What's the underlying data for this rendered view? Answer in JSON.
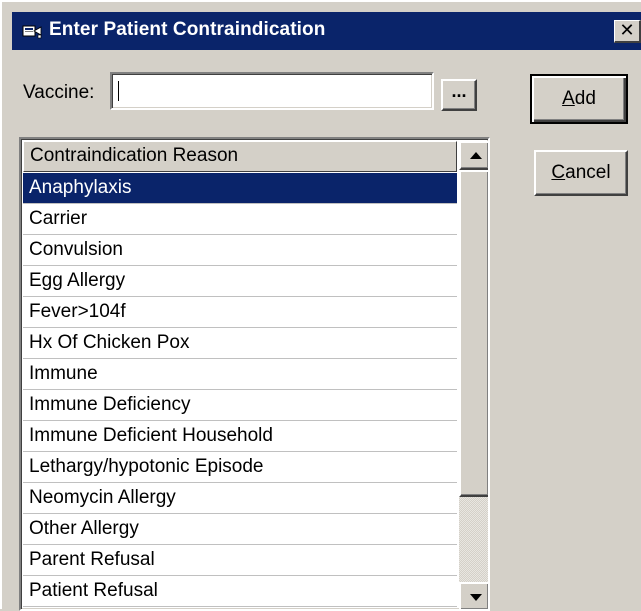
{
  "window": {
    "title": "Enter Patient Contraindication",
    "close_label": "✕",
    "colors": {
      "titlebar": "#0a246a",
      "face": "#d4d0c8",
      "selection": "#0a246a"
    }
  },
  "vaccine": {
    "label": "Vaccine:",
    "value": "",
    "browse_label": "..."
  },
  "buttons": {
    "add": {
      "accel": "A",
      "rest": "dd"
    },
    "cancel": {
      "accel": "C",
      "rest": "ancel"
    }
  },
  "list": {
    "header": "Contraindication Reason",
    "selected_index": 0,
    "items": [
      "Anaphylaxis",
      "Carrier",
      "Convulsion",
      "Egg Allergy",
      "Fever>104f",
      "Hx Of Chicken Pox",
      "Immune",
      "Immune Deficiency",
      "Immune Deficient Household",
      "Lethargy/hypotonic Episode",
      "Neomycin Allergy",
      "Other Allergy",
      "Parent Refusal",
      "Patient Refusal"
    ]
  }
}
